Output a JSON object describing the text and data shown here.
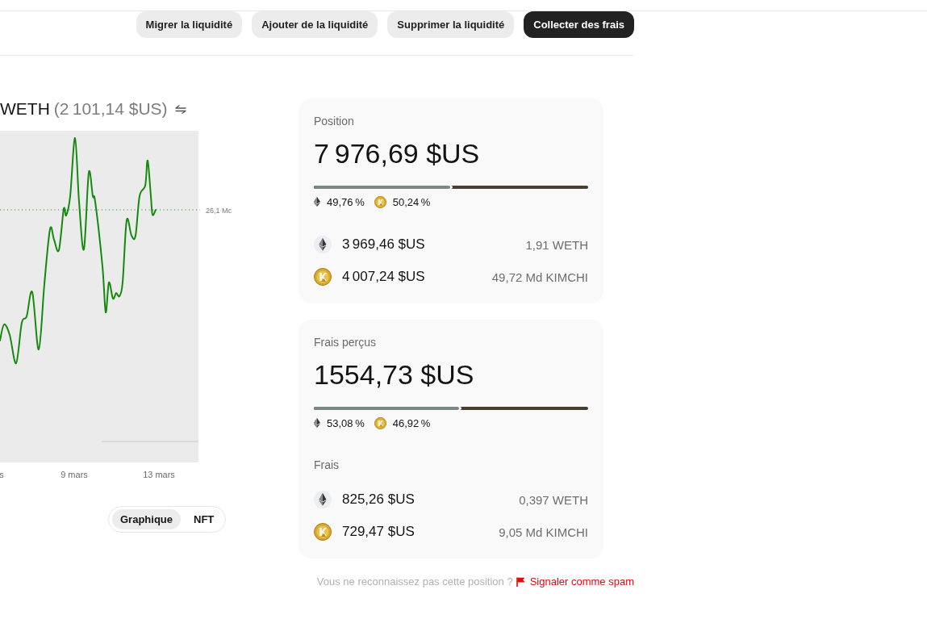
{
  "actions": [
    {
      "label": "Migrer la liquidité",
      "kind": "secondary"
    },
    {
      "label": "Ajouter de la liquidité",
      "kind": "secondary"
    },
    {
      "label": "Supprimer la liquidité",
      "kind": "secondary"
    },
    {
      "label": "Collecter des frais",
      "kind": "primary"
    }
  ],
  "pair": {
    "token": "WETH",
    "price": "(2 101,14 $US)"
  },
  "chart": {
    "price_label": "26,1 Mc",
    "x_labels": [
      "s",
      "9 mars",
      "13 mars"
    ]
  },
  "view_toggle": [
    {
      "label": "Graphique",
      "selected": true
    },
    {
      "label": "NFT",
      "selected": false
    }
  ],
  "position": {
    "title": "Position",
    "total": "7 976,69 $US",
    "split": {
      "level": 0.4976,
      "shares": [
        {
          "kind": "weth",
          "share": "49,76 %"
        },
        {
          "kind": "kimchi",
          "share": "50,24 %"
        }
      ]
    },
    "holdings": [
      {
        "kind": "weth",
        "value": "3 969,46 $US",
        "amount": "1,91 WETH"
      },
      {
        "kind": "kimchi",
        "value": "4 007,24 $US",
        "amount": "49,72 Md KIMCHI"
      }
    ]
  },
  "fees": {
    "title": "Frais perçus",
    "total": "1554,73 $US",
    "split": {
      "level": 0.5308,
      "shares": [
        {
          "kind": "weth",
          "share": "53,08 %"
        },
        {
          "kind": "kimchi",
          "share": "46,92 %"
        }
      ]
    },
    "section_label": "Frais",
    "holdings": [
      {
        "kind": "weth",
        "value": "825,26 $US",
        "amount": "0,397 WETH"
      },
      {
        "kind": "kimchi",
        "value": "729,47 $US",
        "amount": "9,05 Md KIMCHI"
      }
    ]
  },
  "footer": {
    "question": "Vous ne reconnaissez pas cette position ?",
    "report_link": "Signaler comme spam"
  }
}
